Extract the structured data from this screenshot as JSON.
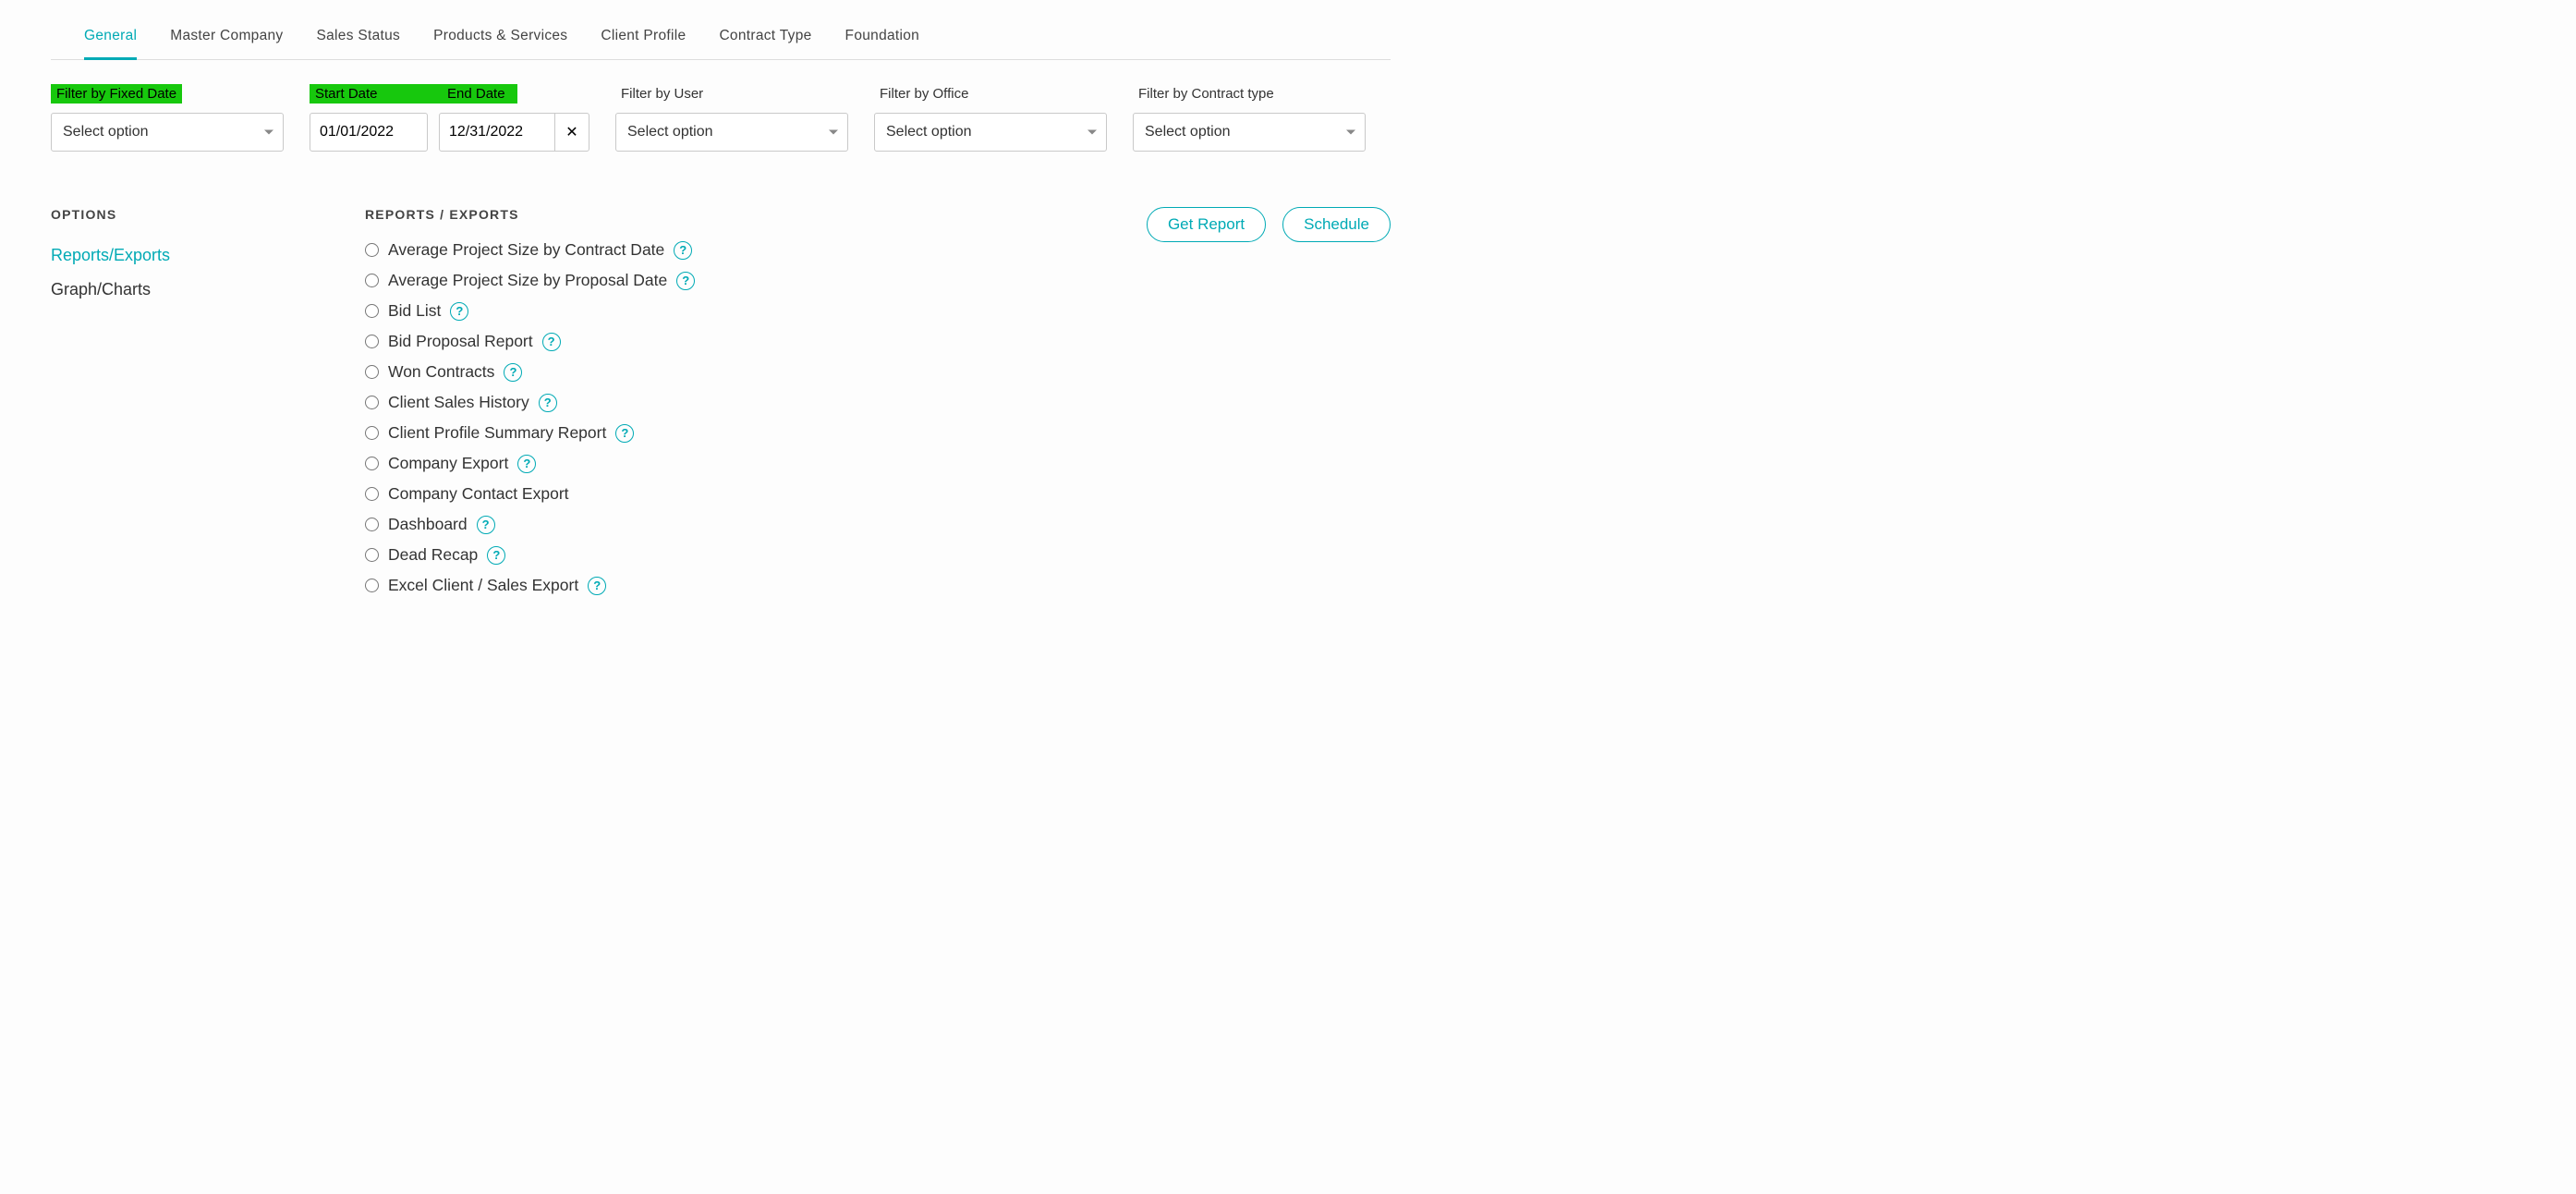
{
  "tabs": [
    {
      "label": "General",
      "active": true
    },
    {
      "label": "Master Company",
      "active": false
    },
    {
      "label": "Sales Status",
      "active": false
    },
    {
      "label": "Products & Services",
      "active": false
    },
    {
      "label": "Client Profile",
      "active": false
    },
    {
      "label": "Contract Type",
      "active": false
    },
    {
      "label": "Foundation",
      "active": false
    }
  ],
  "filters": {
    "fixed_date": {
      "label": "Filter by Fixed Date",
      "value": "Select option",
      "highlight": true
    },
    "date_range": {
      "start_label": "Start Date",
      "end_label": "End Date",
      "start_value": "01/01/2022",
      "end_value": "12/31/2022",
      "highlight": true
    },
    "user": {
      "label": "Filter by User",
      "value": "Select option"
    },
    "office": {
      "label": "Filter by Office",
      "value": "Select option"
    },
    "contract_type": {
      "label": "Filter by Contract type",
      "value": "Select option"
    }
  },
  "options": {
    "heading": "OPTIONS",
    "items": [
      {
        "label": "Reports/Exports",
        "active": true
      },
      {
        "label": "Graph/Charts",
        "active": false
      }
    ]
  },
  "reports": {
    "heading": "REPORTS / EXPORTS",
    "items": [
      {
        "label": "Average Project Size by Contract Date",
        "help": true
      },
      {
        "label": "Average Project Size by Proposal Date",
        "help": true
      },
      {
        "label": "Bid List",
        "help": true
      },
      {
        "label": "Bid Proposal Report",
        "help": true
      },
      {
        "label": "Won Contracts",
        "help": true
      },
      {
        "label": "Client Sales History",
        "help": true
      },
      {
        "label": "Client Profile Summary Report",
        "help": true
      },
      {
        "label": "Company Export",
        "help": true
      },
      {
        "label": "Company Contact Export",
        "help": false
      },
      {
        "label": "Dashboard",
        "help": true
      },
      {
        "label": "Dead Recap",
        "help": true
      },
      {
        "label": "Excel Client / Sales Export",
        "help": true
      }
    ]
  },
  "actions": {
    "get_report": "Get Report",
    "schedule": "Schedule"
  },
  "glyphs": {
    "clear": "✕",
    "help": "?"
  }
}
